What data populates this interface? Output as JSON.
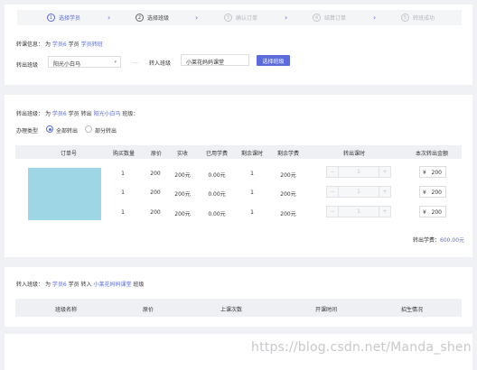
{
  "steps": [
    {
      "num": "1",
      "label": "选择学员"
    },
    {
      "num": "2",
      "label": "选择班级"
    },
    {
      "num": "3",
      "label": "确认订单"
    },
    {
      "num": "4",
      "label": "结算订单"
    },
    {
      "num": "5",
      "label": "转班成功"
    }
  ],
  "transfer_info": {
    "prefix": "转课信息：",
    "for": "为",
    "student": "学员6",
    "student_word": "学员",
    "action": "学员转班"
  },
  "transfer_out_label": "转出班级",
  "transfer_out_select": "阳光小白马",
  "separator": "…",
  "transfer_in_label": "转入班级",
  "transfer_in_value": "小莱花妈妈课堂",
  "select_class_button": "选择班级",
  "out_section": {
    "prefix": "转出班级：",
    "for": "为",
    "student": "学员6",
    "mid": "学员 转出",
    "class_name": "阳光小白马",
    "suffix": "班级："
  },
  "handle_type": {
    "label": "办理类型",
    "options": [
      "全部转出",
      "部分转出"
    ],
    "selected": 0
  },
  "orders_table": {
    "headers": [
      "订单号",
      "购买数量",
      "原价",
      "实收",
      "已用学费",
      "剩余课时",
      "剩余学费",
      "转出课时",
      "本次转出金额"
    ],
    "rows": [
      {
        "qty": "1",
        "price": "200",
        "paid": "200元",
        "used": "0.00元",
        "remain_hours": "1",
        "remain_fee": "200元",
        "out_hours": "1",
        "currency": "¥",
        "amount": "200"
      },
      {
        "qty": "1",
        "price": "200",
        "paid": "200元",
        "used": "0.00元",
        "remain_hours": "1",
        "remain_fee": "200元",
        "out_hours": "1",
        "currency": "¥",
        "amount": "200"
      },
      {
        "qty": "1",
        "price": "200",
        "paid": "200元",
        "used": "0.00元",
        "remain_hours": "1",
        "remain_fee": "200元",
        "out_hours": "1",
        "currency": "¥",
        "amount": "200"
      }
    ],
    "minus": "−",
    "plus": "+"
  },
  "total": {
    "label": "转出学费：",
    "value": "600.00元"
  },
  "in_section": {
    "prefix": "转入班级：",
    "for": "为",
    "student": "学员6",
    "mid": "学员 转入",
    "class_name": "小莱花妈妈课堂",
    "suffix": "班级"
  },
  "in_table": {
    "headers": [
      "班级名称",
      "原价",
      "上课次数",
      "开课时间",
      "招生情况"
    ]
  },
  "watermark": "https://blog.csdn.net/Manda_shen",
  "colors": {
    "accent": "#5b6bdc",
    "background": "#f0f1f4",
    "image_placeholder": "#9ed6e6"
  }
}
